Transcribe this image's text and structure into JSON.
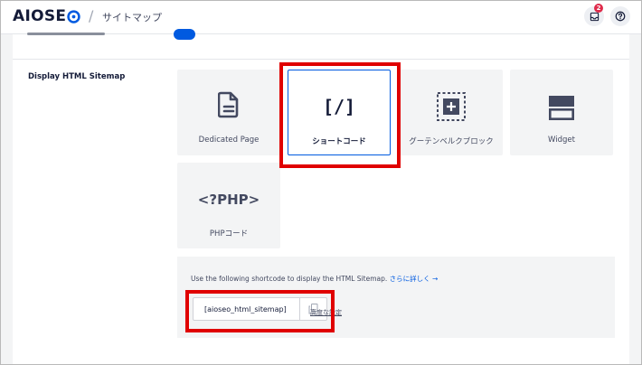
{
  "header": {
    "logo_text": "AIOSEO",
    "separator": "/",
    "breadcrumb": "サイトマップ",
    "notification_count": "2"
  },
  "section": {
    "label": "Display HTML Sitemap"
  },
  "options": [
    {
      "label": "Dedicated Page",
      "icon": "file-icon",
      "selected": false
    },
    {
      "label": "ショートコード",
      "icon": "shortcode-brackets-icon",
      "selected": true,
      "glyph": "[/]"
    },
    {
      "label": "グーテンベルクブロック",
      "icon": "gutenberg-block-icon",
      "selected": false
    },
    {
      "label": "Widget",
      "icon": "widget-icon",
      "selected": false
    },
    {
      "label": "PHPコード",
      "icon": "php-code-icon",
      "selected": false,
      "glyph": "<?PHP>"
    }
  ],
  "shortcode": {
    "description": "Use the following shortcode to display the HTML Sitemap.",
    "learn_more": "さらに詳しく →",
    "code": "[aioseo_html_sitemap]",
    "advanced_link": "高度な設定"
  },
  "colors": {
    "accent": "#005ae0",
    "highlight": "#e00000",
    "text": "#141b38"
  }
}
